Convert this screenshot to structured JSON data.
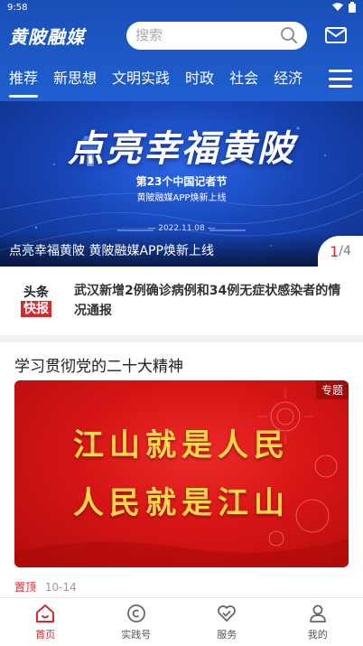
{
  "status_bar": {
    "time": "9:58"
  },
  "header": {
    "logo_text": "黄陂融媒",
    "search_placeholder": "搜索",
    "tabs": [
      "推荐",
      "新思想",
      "文明实践",
      "时政",
      "社会",
      "经济"
    ],
    "active_tab": "推荐"
  },
  "banner": {
    "title": "点亮幸福黄陂",
    "subtitle_line1": "第23个中国记者节",
    "subtitle_line2": "黄陂融媒APP焕新上线",
    "date": "— 2022.11.08 —",
    "caption": "点亮幸福黄陂 黄陂融媒APP焕新上线",
    "pager_current": "1",
    "pager_total": "/4"
  },
  "headline": {
    "logo_top": "头条",
    "logo_bottom": "快报",
    "text": "武汉新增2例确诊病例和34例无症状感染者的情况通报"
  },
  "section": {
    "title": "学习贯彻党的二十大精神",
    "card_tag": "专题",
    "card_line1": "江山就是人民",
    "card_line2": "人民就是江山",
    "meta_pin": "置顶",
    "meta_date": "10-14"
  },
  "bottom_nav": [
    {
      "label": "首页",
      "icon": "home-icon",
      "active": true
    },
    {
      "label": "实践号",
      "icon": "practice-icon",
      "active": false
    },
    {
      "label": "服务",
      "icon": "service-icon",
      "active": false
    },
    {
      "label": "我的",
      "icon": "profile-icon",
      "active": false
    }
  ],
  "colors": {
    "header_blue": "#1f5fd0",
    "accent_red": "#d8292f",
    "card_gold": "#ffd84a"
  }
}
